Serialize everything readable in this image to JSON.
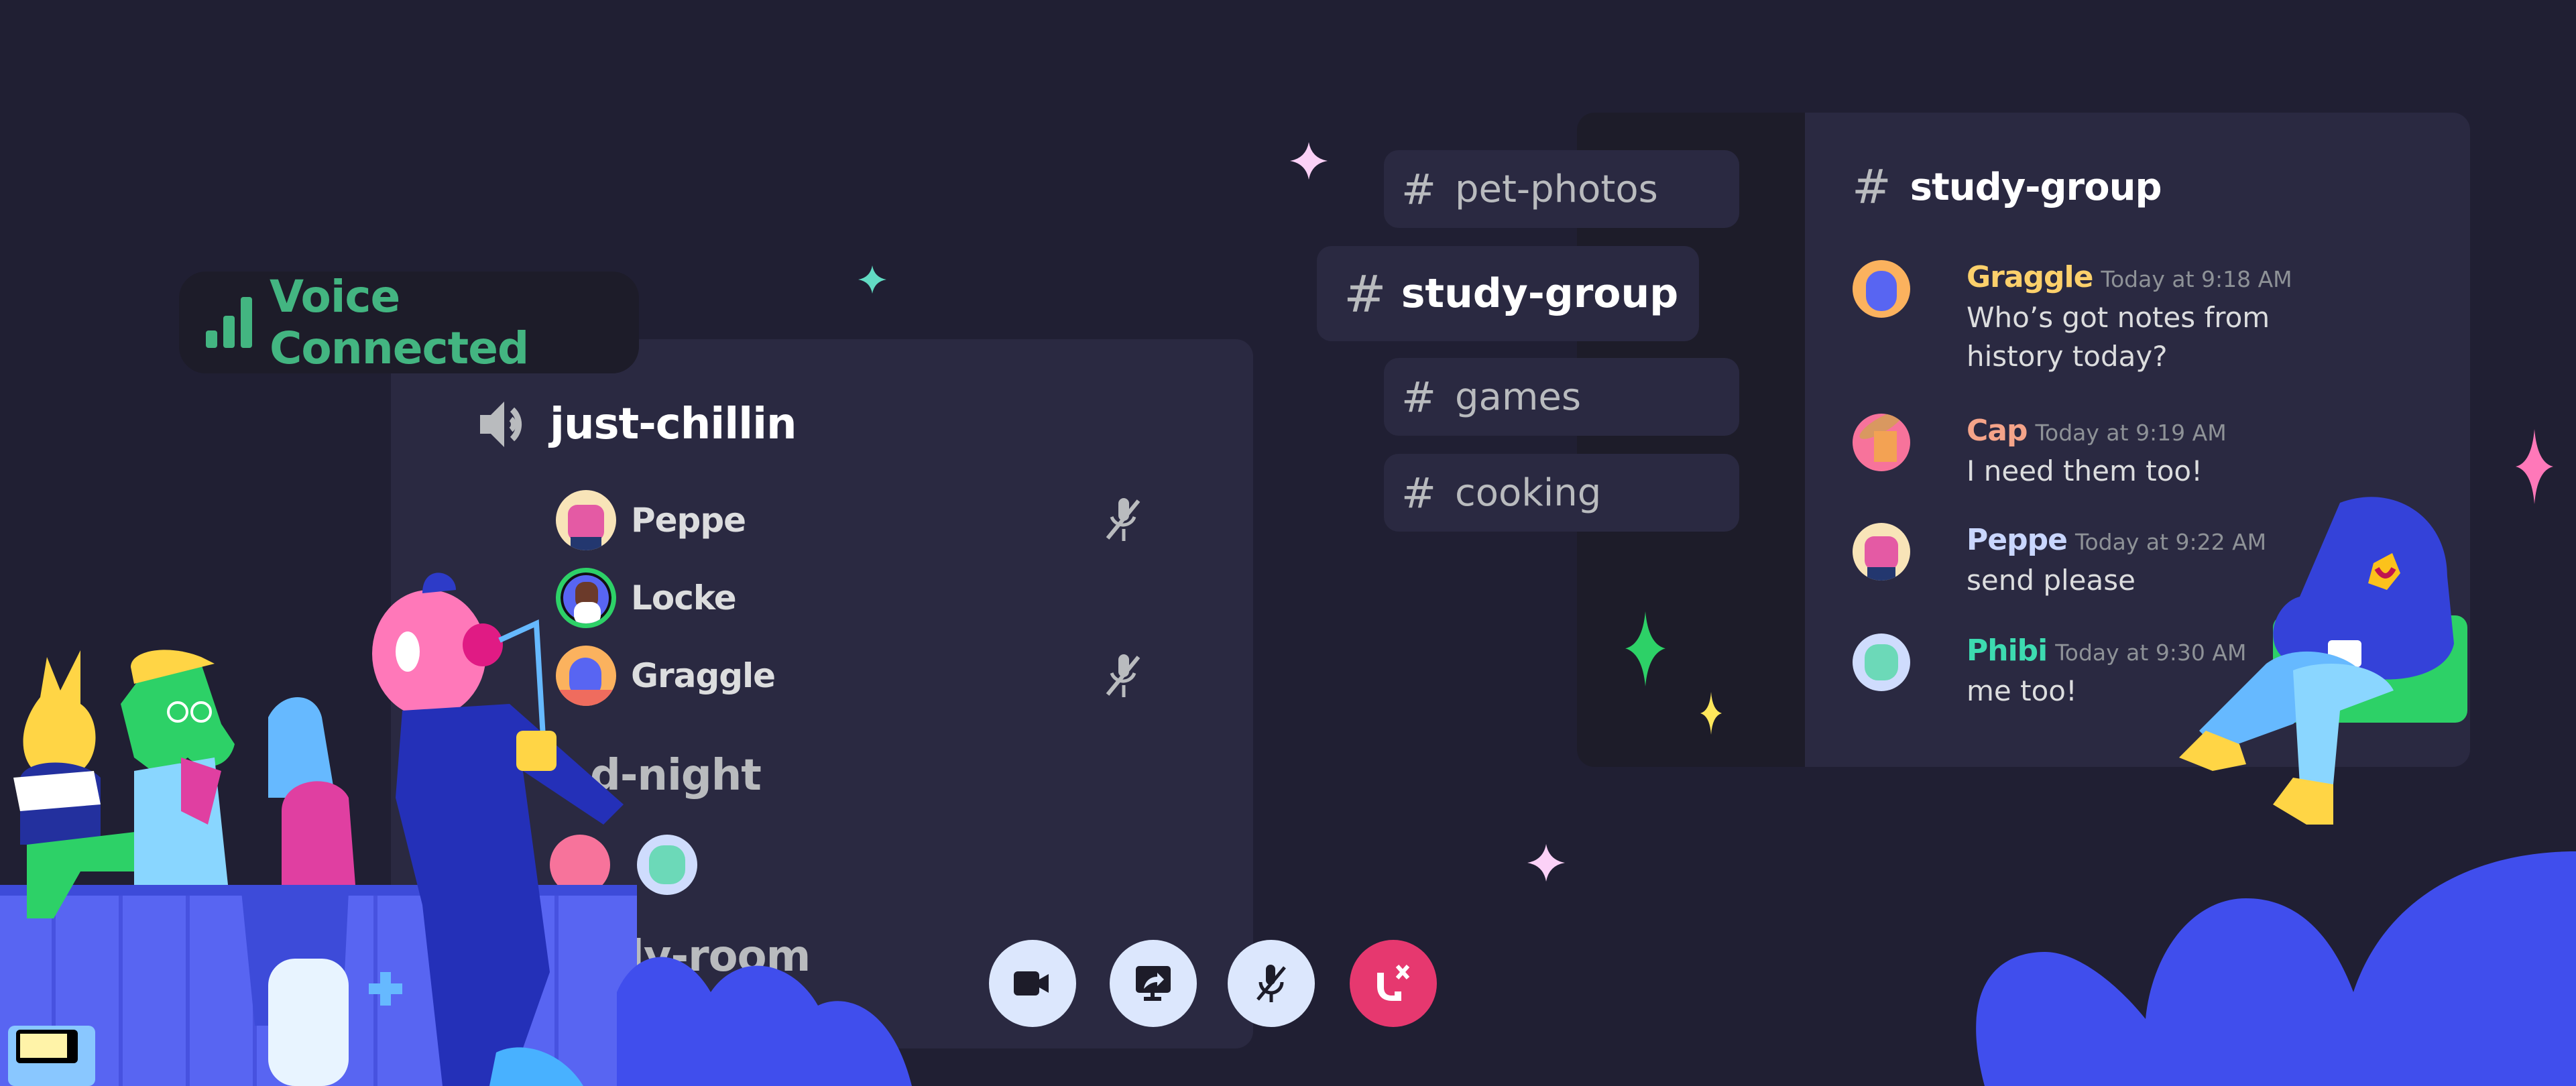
{
  "voice_status": {
    "label": "Voice Connected",
    "color": "#43b581",
    "icon": "signal-bars-icon"
  },
  "voice_channels": {
    "active": {
      "name": "just-chillin",
      "icon": "speaker-icon",
      "members": [
        {
          "name": "Peppe",
          "muted": true,
          "speaking": false,
          "avatar_color": "#f8e4b8"
        },
        {
          "name": "Locke",
          "muted": false,
          "speaking": true,
          "avatar_color": "#5865f2"
        },
        {
          "name": "Graggle",
          "muted": true,
          "speaking": false,
          "avatar_color": "#fbb25e"
        }
      ]
    },
    "others": [
      {
        "name_visible": "d-night",
        "member_avatars": [
          "#f7739b",
          "#cfdcfd"
        ]
      },
      {
        "name_visible": "dy-room"
      }
    ]
  },
  "call_controls": [
    {
      "name": "video-button",
      "icon": "video-camera-icon"
    },
    {
      "name": "screen-share-button",
      "icon": "screen-share-icon"
    },
    {
      "name": "mute-button",
      "icon": "microphone-muted-icon"
    },
    {
      "name": "disconnect-button",
      "icon": "phone-hangup-icon"
    }
  ],
  "text_channels": [
    {
      "name": "pet-photos",
      "active": false
    },
    {
      "name": "study-group",
      "active": true
    },
    {
      "name": "games",
      "active": false
    },
    {
      "name": "cooking",
      "active": false
    }
  ],
  "chat": {
    "channel": "study-group",
    "messages": [
      {
        "author": "Graggle",
        "author_color": "#fcd06b",
        "time": "Today at 9:18 AM",
        "text": "Who’s got notes from history today?",
        "avatar_color": "#fbb25e"
      },
      {
        "author": "Cap",
        "author_color": "#f5a489",
        "time": "Today at 9:19 AM",
        "text": "I need them too!",
        "avatar_color": "#f7739b"
      },
      {
        "author": "Peppe",
        "author_color": "#c9d6fe",
        "time": "Today at 9:22 AM",
        "text": "send please",
        "avatar_color": "#f8e4b8"
      },
      {
        "author": "Phibi",
        "author_color": "#3ddbb0",
        "time": "Today at 9:30 AM",
        "text": "me too!",
        "avatar_color": "#cfdcfd"
      }
    ]
  },
  "colors": {
    "background": "#201f33",
    "panel": "#2a2941",
    "panel_dark": "#1d1c29",
    "blurple": "#404eed",
    "danger": "#e6386f",
    "control_bg": "#dce7fd"
  }
}
